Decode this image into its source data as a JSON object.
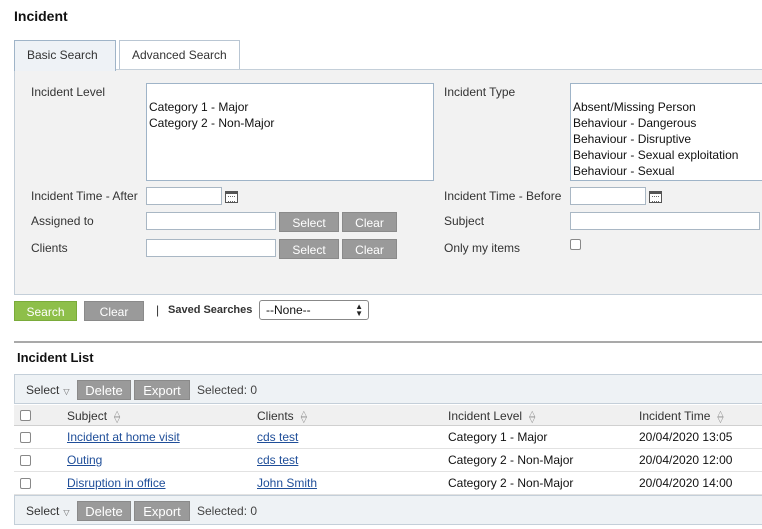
{
  "page": {
    "title": "Incident"
  },
  "tabs": [
    {
      "label": "Basic Search",
      "active": true
    },
    {
      "label": "Advanced Search",
      "active": false
    }
  ],
  "search_form": {
    "incident_level": {
      "label": "Incident Level",
      "options": [
        "Category 1 - Major",
        "Category 2 - Non-Major"
      ]
    },
    "incident_type": {
      "label": "Incident Type",
      "options": [
        "Absent/Missing Person",
        "Behaviour - Dangerous",
        "Behaviour - Disruptive",
        "Behaviour - Sexual exploitation",
        "Behaviour - Sexual"
      ]
    },
    "time_after": {
      "label": "Incident Time - After",
      "value": ""
    },
    "time_before": {
      "label": "Incident Time - Before",
      "value": ""
    },
    "assigned_to": {
      "label": "Assigned to",
      "value": "",
      "select_label": "Select",
      "clear_label": "Clear"
    },
    "subject": {
      "label": "Subject",
      "value": ""
    },
    "clients": {
      "label": "Clients",
      "value": "",
      "select_label": "Select",
      "clear_label": "Clear"
    },
    "only_my_items": {
      "label": "Only my items",
      "checked": false
    }
  },
  "actions": {
    "search_label": "Search",
    "clear_label": "Clear",
    "separator": "|",
    "saved_searches_label": "Saved Searches",
    "saved_searches_value": "--None--"
  },
  "list": {
    "title": "Incident List",
    "toolbar": {
      "select_label": "Select",
      "delete_label": "Delete",
      "export_label": "Export",
      "selected_text": "Selected: 0"
    },
    "columns": [
      "Subject",
      "Clients",
      "Incident Level",
      "Incident Time"
    ],
    "rows": [
      {
        "subject": "Incident at home visit",
        "clients": "cds test",
        "level": "Category 1 - Major",
        "time": "20/04/2020 13:05"
      },
      {
        "subject": "Outing",
        "clients": "cds test",
        "level": "Category 2 - Non-Major",
        "time": "20/04/2020 12:00"
      },
      {
        "subject": "Disruption in office",
        "clients": "John Smith",
        "level": "Category 2 - Non-Major",
        "time": "20/04/2020 14:00"
      }
    ]
  },
  "colors": {
    "search_button": "#8ebf4a",
    "gray_button": "#9a9a9a",
    "link": "#1f4e99",
    "panel": "#f2f2f2"
  }
}
